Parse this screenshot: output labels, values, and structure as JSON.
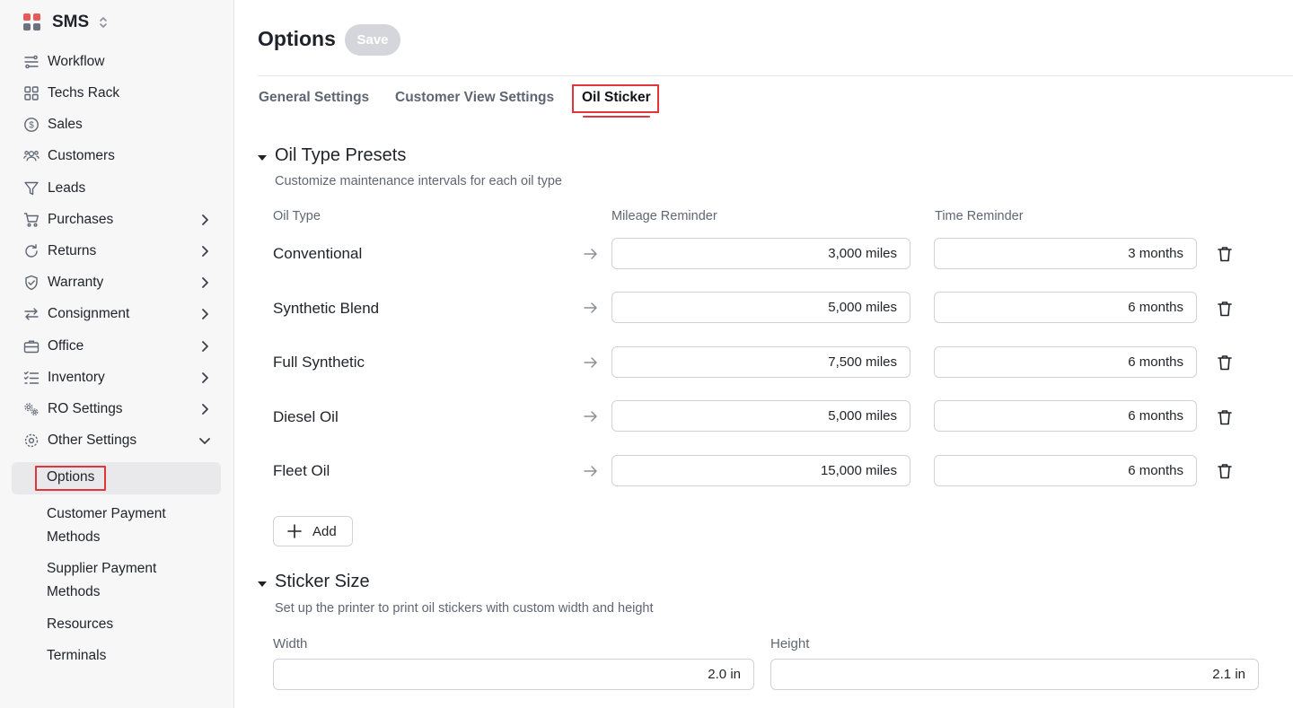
{
  "brand": {
    "name": "SMS"
  },
  "sidebar": {
    "items": [
      {
        "label": "Workflow",
        "icon": "workflow-icon"
      },
      {
        "label": "Techs Rack",
        "icon": "grid-icon"
      },
      {
        "label": "Sales",
        "icon": "dollar-circle-icon"
      },
      {
        "label": "Customers",
        "icon": "users-icon"
      },
      {
        "label": "Leads",
        "icon": "funnel-icon"
      },
      {
        "label": "Purchases",
        "icon": "cart-icon"
      },
      {
        "label": "Returns",
        "icon": "refresh-icon"
      },
      {
        "label": "Warranty",
        "icon": "shield-check-icon"
      },
      {
        "label": "Consignment",
        "icon": "swap-icon"
      },
      {
        "label": "Office",
        "icon": "briefcase-icon"
      },
      {
        "label": "Inventory",
        "icon": "list-check-icon"
      },
      {
        "label": "RO Settings",
        "icon": "gears-icon"
      },
      {
        "label": "Other Settings",
        "icon": "gear-icon"
      }
    ],
    "sub_items": {
      "options": "Options",
      "customer_payment_line1": "Customer Payment",
      "customer_payment_line2": "Methods",
      "supplier_payment_line1": "Supplier Payment",
      "supplier_payment_line2": "Methods",
      "resources": "Resources",
      "terminals": "Terminals"
    }
  },
  "header": {
    "title": "Options",
    "save_label": "Save"
  },
  "tabs": {
    "general": "General Settings",
    "customer_view": "Customer View Settings",
    "oil_sticker": "Oil Sticker"
  },
  "oil_presets": {
    "title": "Oil Type Presets",
    "description": "Customize maintenance intervals for each oil type",
    "col_oil_type": "Oil Type",
    "col_mileage": "Mileage Reminder",
    "col_time": "Time Reminder",
    "rows": [
      {
        "oil_type": "Conventional",
        "mileage": "3,000 miles",
        "time": "3 months"
      },
      {
        "oil_type": "Synthetic Blend",
        "mileage": "5,000 miles",
        "time": "6 months"
      },
      {
        "oil_type": "Full Synthetic",
        "mileage": "7,500 miles",
        "time": "6 months"
      },
      {
        "oil_type": "Diesel Oil",
        "mileage": "5,000 miles",
        "time": "6 months"
      },
      {
        "oil_type": "Fleet Oil",
        "mileage": "15,000 miles",
        "time": "6 months"
      }
    ],
    "add_label": "Add"
  },
  "sticker_size": {
    "title": "Sticker Size",
    "description": "Set up the printer to print oil stickers with custom width and height",
    "width_label": "Width",
    "width_value": "2.0 in",
    "height_label": "Height",
    "height_value": "2.1 in"
  },
  "colors": {
    "accent_red": "#e0353c",
    "save_disabled": "#d4d6db"
  }
}
